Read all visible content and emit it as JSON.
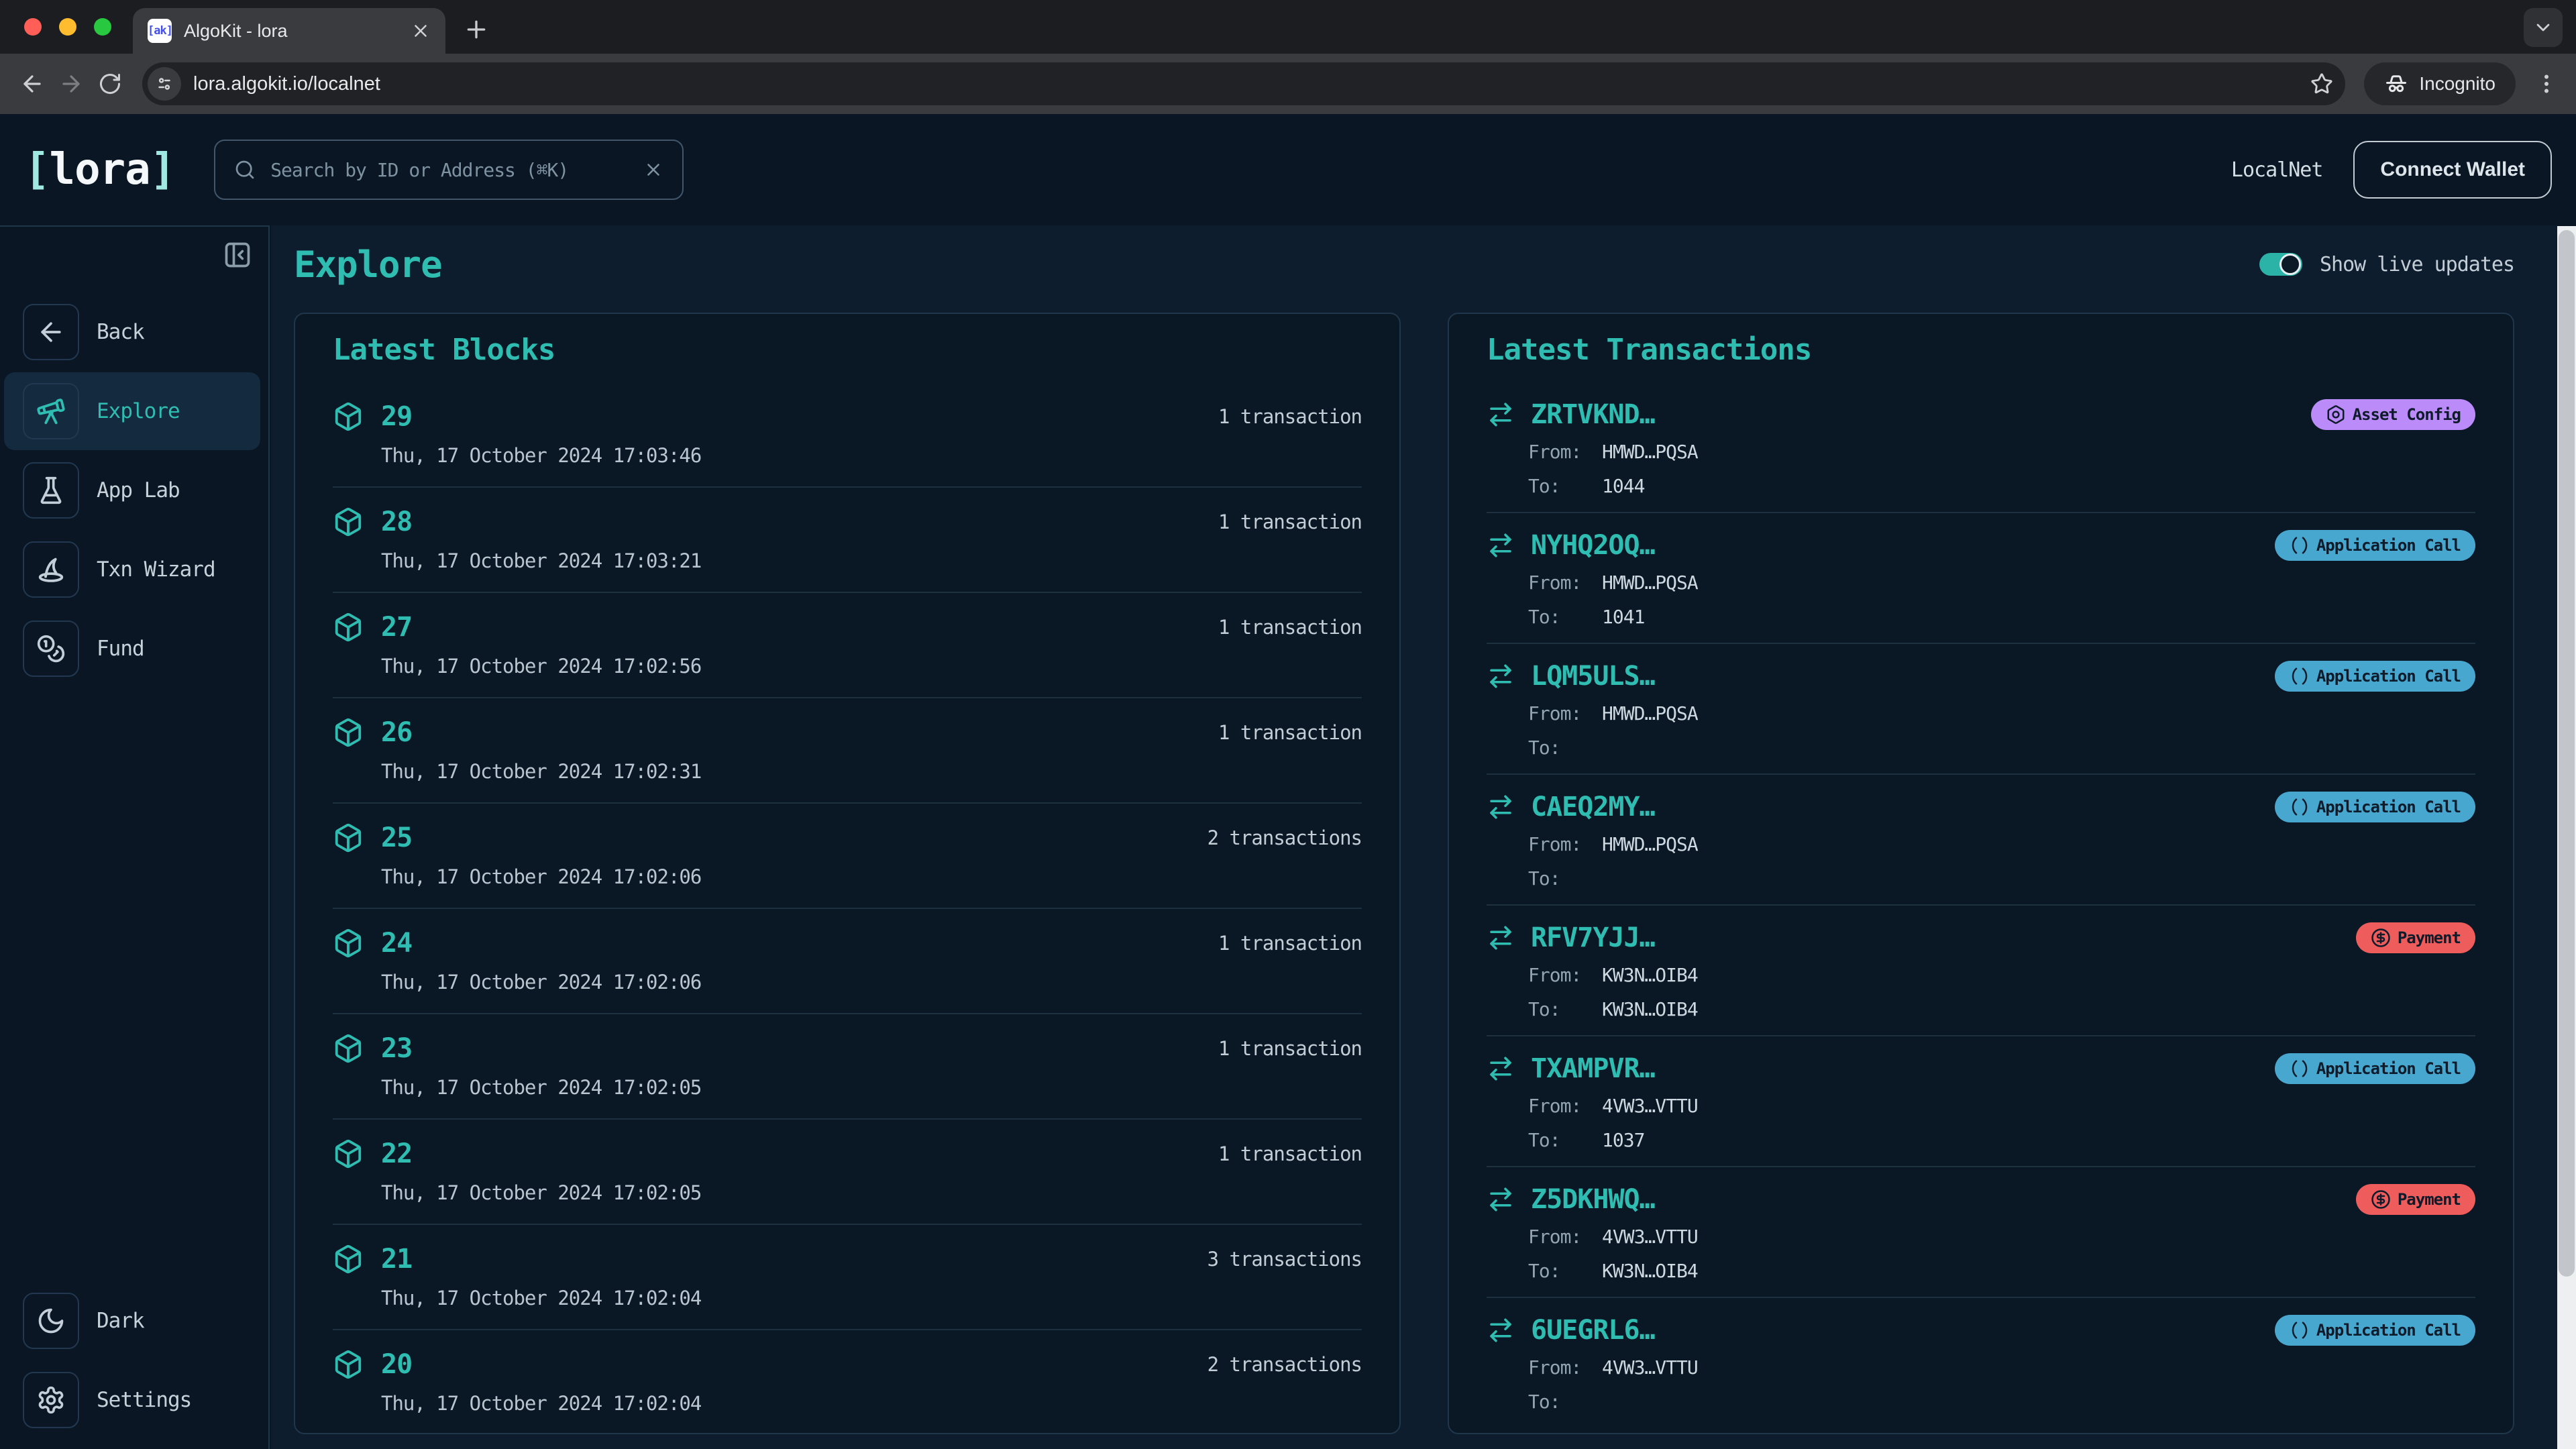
{
  "theme": {
    "bg": "#0a1624",
    "bg-main": "#0e1d2e",
    "card": "#0a1725",
    "border": "#20364b",
    "divider": "#1c3040",
    "accent": "#2fbdb2",
    "accent-soft": "#9fe9e2",
    "toggle": "#2bb3a8",
    "badge-purple": "#bb8bf9",
    "badge-blue": "#47a7cf",
    "badge-red": "#ee5c5c",
    "badge-text": "#0d1b2a"
  },
  "browser": {
    "tab_title": "AlgoKit - lora",
    "favicon_text": "[ak]",
    "url": "lora.algokit.io/localnet",
    "incognito_label": "Incognito"
  },
  "header": {
    "logo_open": "[",
    "logo_text": "lora",
    "logo_close": "]",
    "search_placeholder": "Search by ID or Address (⌘K)",
    "network_label": "LocalNet",
    "connect_wallet_label": "Connect Wallet"
  },
  "sidebar": {
    "items": [
      {
        "label": "Back"
      },
      {
        "label": "Explore"
      },
      {
        "label": "App Lab"
      },
      {
        "label": "Txn Wizard"
      },
      {
        "label": "Fund"
      }
    ],
    "bottom_items": [
      {
        "label": "Dark"
      },
      {
        "label": "Settings"
      }
    ]
  },
  "page": {
    "title": "Explore",
    "live_updates_label": "Show live updates",
    "live_updates_on": true
  },
  "blocks": {
    "title": "Latest Blocks",
    "rows": [
      {
        "number": "29",
        "timestamp": "Thu, 17 October 2024 17:03:46",
        "transactions": "1 transaction"
      },
      {
        "number": "28",
        "timestamp": "Thu, 17 October 2024 17:03:21",
        "transactions": "1 transaction"
      },
      {
        "number": "27",
        "timestamp": "Thu, 17 October 2024 17:02:56",
        "transactions": "1 transaction"
      },
      {
        "number": "26",
        "timestamp": "Thu, 17 October 2024 17:02:31",
        "transactions": "1 transaction"
      },
      {
        "number": "25",
        "timestamp": "Thu, 17 October 2024 17:02:06",
        "transactions": "2 transactions"
      },
      {
        "number": "24",
        "timestamp": "Thu, 17 October 2024 17:02:06",
        "transactions": "1 transaction"
      },
      {
        "number": "23",
        "timestamp": "Thu, 17 October 2024 17:02:05",
        "transactions": "1 transaction"
      },
      {
        "number": "22",
        "timestamp": "Thu, 17 October 2024 17:02:05",
        "transactions": "1 transaction"
      },
      {
        "number": "21",
        "timestamp": "Thu, 17 October 2024 17:02:04",
        "transactions": "3 transactions"
      },
      {
        "number": "20",
        "timestamp": "Thu, 17 October 2024 17:02:04",
        "transactions": "2 transactions"
      }
    ]
  },
  "transactions": {
    "title": "Latest Transactions",
    "from_label": "From:",
    "to_label": "To:",
    "rows": [
      {
        "id": "ZRTVKND…",
        "type": "Asset Config",
        "from": "HMWD…PQSA",
        "to": "1044"
      },
      {
        "id": "NYHQ2OQ…",
        "type": "Application Call",
        "from": "HMWD…PQSA",
        "to": "1041"
      },
      {
        "id": "LQM5ULS…",
        "type": "Application Call",
        "from": "HMWD…PQSA",
        "to": ""
      },
      {
        "id": "CAEQ2MY…",
        "type": "Application Call",
        "from": "HMWD…PQSA",
        "to": ""
      },
      {
        "id": "RFV7YJJ…",
        "type": "Payment",
        "from": "KW3N…OIB4",
        "to": "KW3N…OIB4"
      },
      {
        "id": "TXAMPVR…",
        "type": "Application Call",
        "from": "4VW3…VTTU",
        "to": "1037"
      },
      {
        "id": "Z5DKHWQ…",
        "type": "Payment",
        "from": "4VW3…VTTU",
        "to": "KW3N…OIB4"
      },
      {
        "id": "6UEGRL6…",
        "type": "Application Call",
        "from": "4VW3…VTTU",
        "to": ""
      }
    ]
  }
}
